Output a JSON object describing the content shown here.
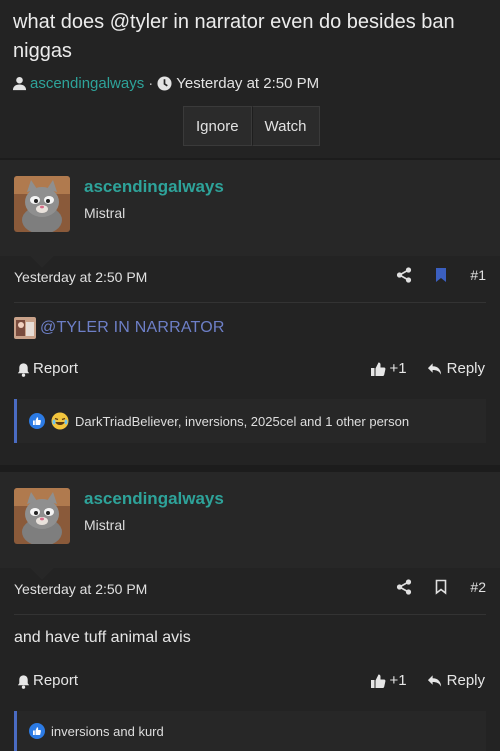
{
  "thread": {
    "title": "what does @tyler in narrator even do besides ban niggas",
    "author": "ascendingalways",
    "separator": "·",
    "timestamp": "Yesterday at 2:50 PM",
    "buttons": {
      "ignore": "Ignore",
      "watch": "Watch"
    }
  },
  "posts": [
    {
      "username": "ascendingalways",
      "user_title": "Mistral",
      "date": "Yesterday at 2:50 PM",
      "number": "#1",
      "bookmarked": true,
      "mention": "@TYLER IN NARRATOR",
      "report_label": "Report",
      "like_label": "+1",
      "reply_label": "Reply",
      "reactions_text": "DarkTriadBeliever, inversions, 2025cel and 1 other person"
    },
    {
      "username": "ascendingalways",
      "user_title": "Mistral",
      "date": "Yesterday at 2:50 PM",
      "number": "#2",
      "bookmarked": false,
      "body": "and have tuff animal avis",
      "report_label": "Report",
      "like_label": "+1",
      "reply_label": "Reply",
      "reactions_text": "inversions and kurd"
    }
  ],
  "colors": {
    "accent": "#2ea39a",
    "mention": "#6d7fc7",
    "bookmark": "#3b5fc0",
    "reaction_bar": "#4a6bc2"
  }
}
